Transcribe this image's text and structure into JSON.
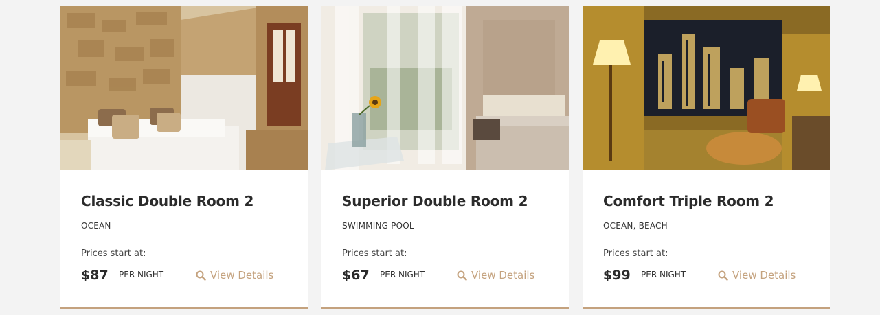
{
  "rooms": [
    {
      "title": "Classic Double Room 2",
      "tags": "OCEAN",
      "price_label": "Prices start at:",
      "price": "$87",
      "per_night": "PER NIGHT",
      "details_label": "View Details"
    },
    {
      "title": "Superior Double Room 2",
      "tags": "SWIMMING POOL",
      "price_label": "Prices start at:",
      "price": "$67",
      "per_night": "PER NIGHT",
      "details_label": "View Details"
    },
    {
      "title": "Comfort Triple Room 2",
      "tags": "OCEAN, BEACH",
      "price_label": "Prices start at:",
      "price": "$99",
      "per_night": "PER NIGHT",
      "details_label": "View Details"
    }
  ],
  "colors": {
    "accent": "#c4a27e",
    "background": "#f3f3f3",
    "card": "#ffffff",
    "text": "#2b2b2b"
  },
  "icons": {
    "details": "search-icon"
  }
}
